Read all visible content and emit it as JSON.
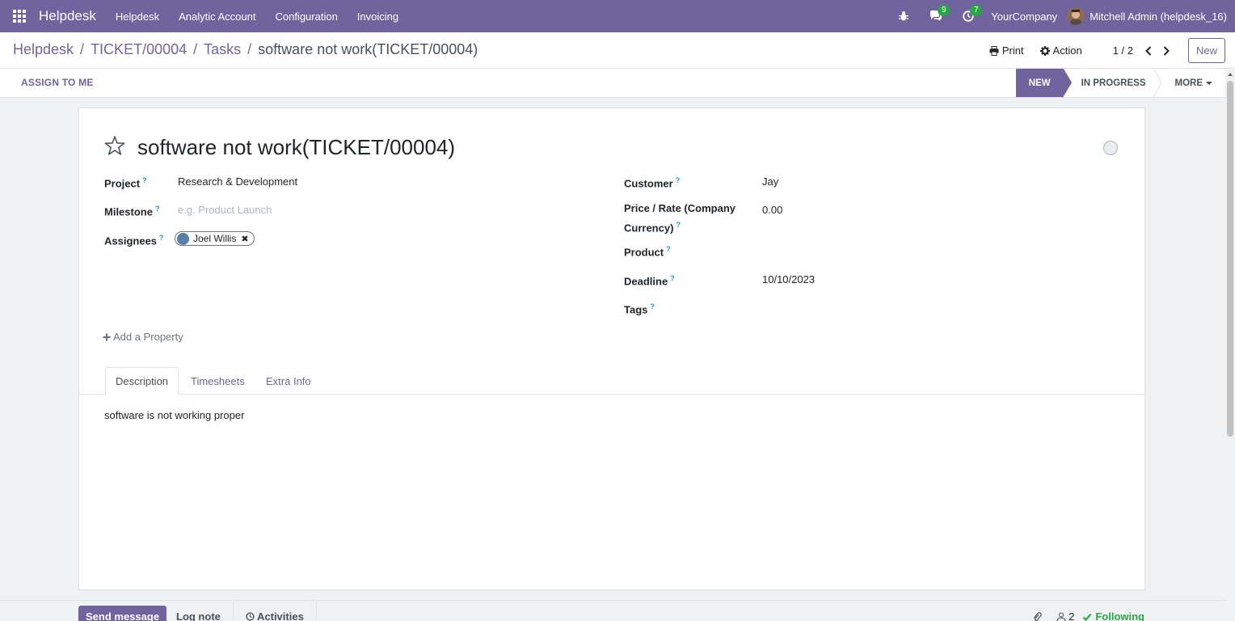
{
  "navbar": {
    "brand": "Helpdesk",
    "menu": [
      "Helpdesk",
      "Analytic Account",
      "Configuration",
      "Invoicing"
    ],
    "messages_count": "9",
    "activities_count": "7",
    "company": "YourCompany",
    "user": "Mitchell Admin (helpdesk_16)"
  },
  "breadcrumb": {
    "items": [
      "Helpdesk",
      "TICKET/00004",
      "Tasks"
    ],
    "sep": "/",
    "current": "software not work(TICKET/00004)"
  },
  "control": {
    "print": "Print",
    "action": "Action",
    "pager": "1 / 2",
    "new": "New"
  },
  "statusbar": {
    "assign": "ASSIGN TO ME",
    "stages": [
      "NEW",
      "IN PROGRESS",
      "MORE"
    ]
  },
  "form": {
    "title": "software not work(TICKET/00004)",
    "help_mark": "?",
    "left": {
      "project_label": "Project",
      "project_value": "Research & Development",
      "milestone_label": "Milestone",
      "milestone_placeholder": "e.g. Product Launch",
      "assignees_label": "Assignees",
      "assignee": "Joel Willis"
    },
    "right": {
      "customer_label": "Customer",
      "customer_value": "Jay",
      "price_label_1": "Price / Rate (Company",
      "price_label_2": "Currency)",
      "price_value": "0.00",
      "product_label": "Product",
      "deadline_label": "Deadline",
      "deadline_value": "10/10/2023",
      "tags_label": "Tags"
    },
    "add_property": "Add a Property",
    "tabs": [
      "Description",
      "Timesheets",
      "Extra Info"
    ],
    "description": "software is not working proper"
  },
  "chatter": {
    "send": "Send message",
    "log": "Log note",
    "activities": "Activities",
    "followers": "2",
    "following": "Following"
  },
  "colors": {
    "brand": "#71639e",
    "success": "#28a745",
    "help": "#17a2b8"
  }
}
